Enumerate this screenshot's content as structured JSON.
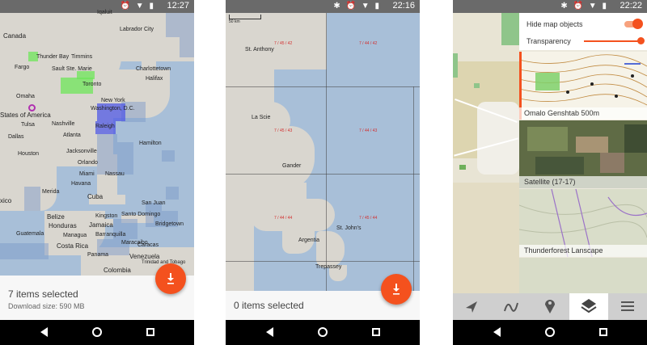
{
  "screens": [
    {
      "status_time": "12:27",
      "status_icons": "⏰ ▼ ▮",
      "map_labels": [
        "Canada",
        "Iqaluit",
        "Labrador City",
        "Thunder Bay",
        "Timmins",
        "Charlottetown",
        "Fargo",
        "Sault Ste. Marie",
        "Halifax",
        "Toronto",
        "Omaha",
        "New York",
        "States of America",
        "Washington, D.C.",
        "Tulsa",
        "Nashville",
        "Raleigh",
        "Dallas",
        "Atlanta",
        "Hamilton",
        "Houston",
        "Jacksonville",
        "Orlando",
        "Miami",
        "Nassau",
        "xico",
        "Merida",
        "Havana",
        "Cuba",
        "San Juan",
        "Kingston",
        "Belize",
        "Jamaica",
        "Santo Domingo",
        "Honduras",
        "Bridgetown",
        "Managua",
        "Barranquilla",
        "Costa Rica",
        "Maracaibo",
        "Panama",
        "Caracas",
        "Venezuela",
        "Colombia",
        "Guatemala",
        "Trinidad and Tobago"
      ],
      "selected_count_text": "7 items selected",
      "download_size_text": "Download size: 590 MB",
      "fab_icon": "download-icon"
    },
    {
      "status_time": "22:16",
      "status_icons": "✱ ⏰ ▼ ▮",
      "scale_label": "50 km",
      "map_labels": [
        "St. Anthony",
        "La Scie",
        "Gander",
        "Argentia",
        "St. John's",
        "Trepassey"
      ],
      "tile_labels": [
        "7 / 45 / 42",
        "7 / 44 / 42",
        "7 / 45 / 43",
        "7 / 44 / 43",
        "7 / 44 / 44",
        "7 / 45 / 44"
      ],
      "selected_count_text": "0 items selected",
      "fab_icon": "download-icon"
    },
    {
      "status_time": "22:22",
      "status_icons": "✱ ⏰ ▼ ▮",
      "hide_map_objects_label": "Hide map objects",
      "transparency_label": "Transparency",
      "hide_map_objects_on": true,
      "transparency_value": 1.0,
      "layers": [
        {
          "caption": "Omalo Genshtab 500m"
        },
        {
          "caption": "Satellite (17-17)"
        },
        {
          "caption": "Thunderforest Lanscape"
        }
      ],
      "toolbar_icons": [
        "navigation-arrow-icon",
        "route-icon",
        "place-pin-icon",
        "layers-icon",
        "menu-icon"
      ],
      "active_toolbar_index": 3
    }
  ],
  "colors": {
    "accent": "#f4511e",
    "water": "#a8bfd8",
    "land": "#d9d6cf"
  }
}
